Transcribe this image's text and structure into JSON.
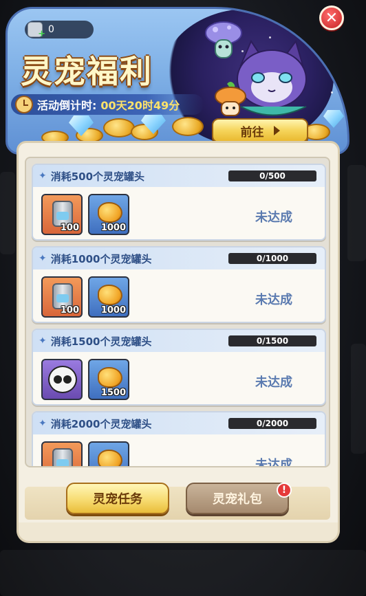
{
  "header": {
    "title": "灵宠福利",
    "countdown_label": "活动倒计时:",
    "countdown_value": "00天20时49分",
    "resource_count": "0",
    "goto_label": "前往"
  },
  "tasks": [
    {
      "title": "消耗500个灵宠罐头",
      "progress_text": "0/500",
      "progress": 0,
      "status": "未达成",
      "rewards": [
        {
          "icon": "pet-can-icon",
          "qty": "100"
        },
        {
          "icon": "gold-nugget-icon",
          "qty": "1000"
        }
      ]
    },
    {
      "title": "消耗1000个灵宠罐头",
      "progress_text": "0/1000",
      "progress": 0,
      "status": "未达成",
      "rewards": [
        {
          "icon": "pet-can-icon",
          "qty": "100"
        },
        {
          "icon": "gold-nugget-icon",
          "qty": "1000"
        }
      ]
    },
    {
      "title": "消耗1500个灵宠罐头",
      "progress_text": "0/1500",
      "progress": 0,
      "status": "未达成",
      "rewards": [
        {
          "icon": "panda-pet-icon",
          "qty": ""
        },
        {
          "icon": "gold-nugget-icon",
          "qty": "1500"
        }
      ]
    },
    {
      "title": "消耗2000个灵宠罐头",
      "progress_text": "0/2000",
      "progress": 0,
      "status": "未达成",
      "rewards": [
        {
          "icon": "pet-can-icon",
          "qty": ""
        },
        {
          "icon": "gold-nugget-icon",
          "qty": ""
        }
      ]
    }
  ],
  "tabs": [
    {
      "label": "灵宠任务"
    },
    {
      "label": "灵宠礼包"
    }
  ],
  "badge": "!",
  "colors": {
    "accent_gold": "#f5d45a",
    "title_text": "#2e4f86",
    "status_text": "#5b7bb0",
    "badge_red": "#e53a3a"
  }
}
